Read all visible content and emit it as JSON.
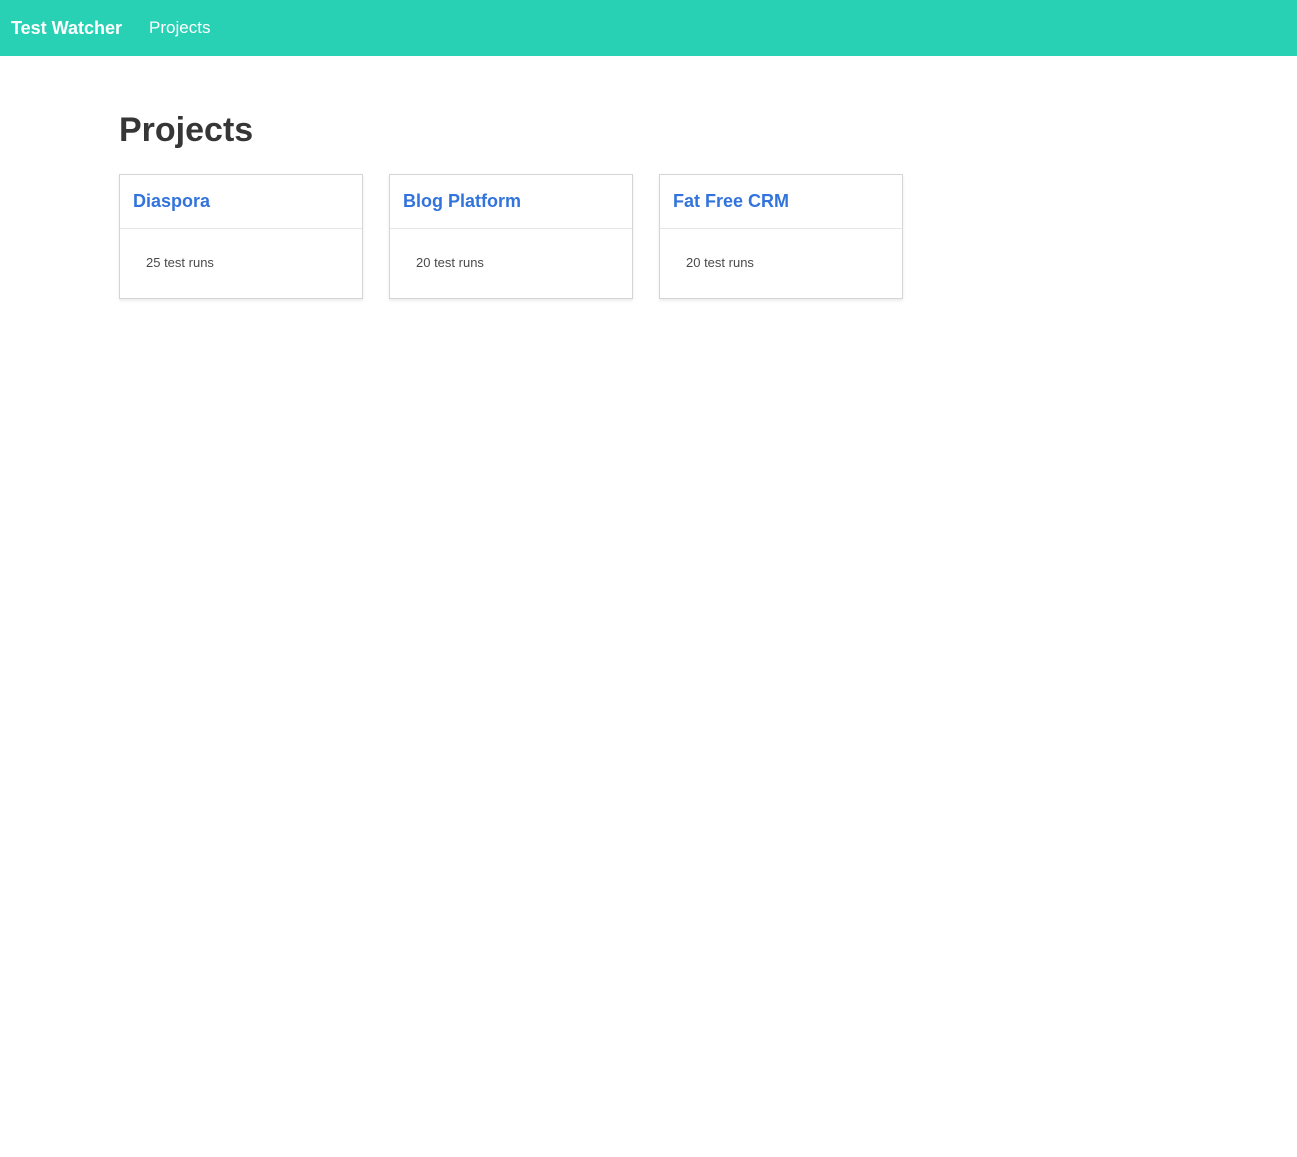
{
  "navbar": {
    "brand": "Test Watcher",
    "links": [
      "Projects"
    ]
  },
  "main": {
    "title": "Projects",
    "projects": [
      {
        "name": "Diaspora",
        "runs": "25 test runs"
      },
      {
        "name": "Blog Platform",
        "runs": "20 test runs"
      },
      {
        "name": "Fat Free CRM",
        "runs": "20 test runs"
      }
    ]
  },
  "colors": {
    "navbar": "#29d1b4",
    "link": "#3273dc"
  }
}
